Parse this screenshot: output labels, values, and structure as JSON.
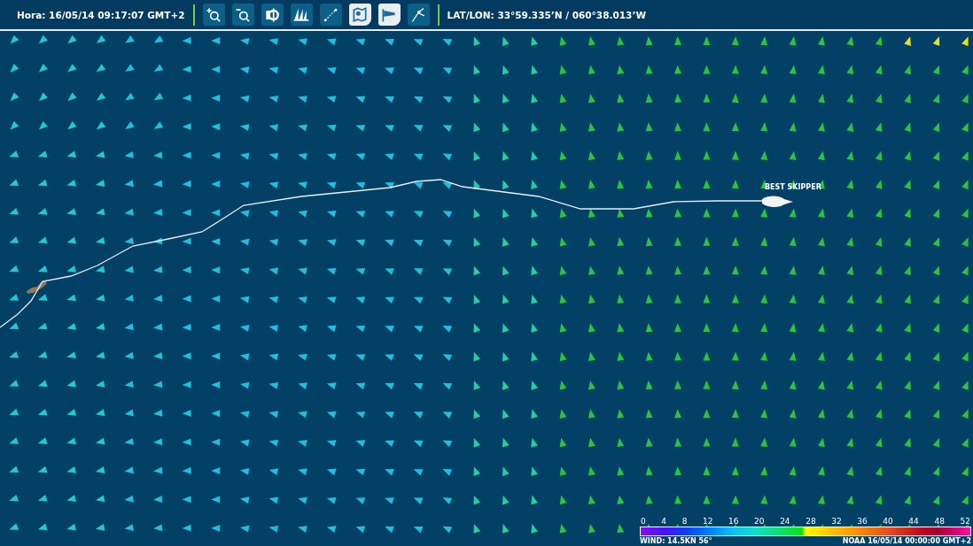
{
  "toolbar": {
    "time": "Hora: 16/05/14 09:17:07 GMT+2",
    "tools": [
      {
        "kind": "zoom-in",
        "active": false
      },
      {
        "kind": "zoom-out",
        "active": false
      },
      {
        "kind": "center",
        "active": false
      },
      {
        "kind": "fleet",
        "active": false
      },
      {
        "kind": "measure",
        "active": false
      },
      {
        "kind": "chart",
        "active": true
      },
      {
        "kind": "wind",
        "active": true
      },
      {
        "kind": "dividers",
        "active": false
      }
    ],
    "position": "LAT/LON: 33°59.335’N / 060°38.013’W"
  },
  "map": {
    "boat_label": "BEST SKIPPER"
  },
  "legend": {
    "ticks": [
      "0",
      "4",
      "8",
      "12",
      "16",
      "20",
      "24",
      "28",
      "32",
      "36",
      "40",
      "44",
      "48",
      "52"
    ],
    "wind": "WIND: 14.5KN 56°",
    "model": "NOAA 16/05/14 00:00:00 GMT+2"
  }
}
